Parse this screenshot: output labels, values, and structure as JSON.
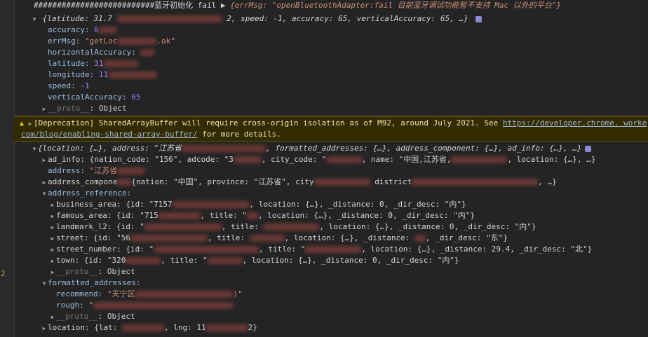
{
  "gutter": {
    "line_number": "2"
  },
  "log": {
    "head_prefix": "##########################蓝牙初始化 fail ▶",
    "head_obj": "{errMsg: \"openBluetoothAdapter:fail 目前蓝牙调试功能暂不支持 Mac 以外的平台\"}",
    "loc_summary_a": "{latitude: 31.7",
    "loc_summary_b": "2, speed: -1, accuracy: 65, verticalAccuracy: 65, …}",
    "accuracy_key": "accuracy: ",
    "accuracy_val": "6",
    "errmsg_key": "errMsg: ",
    "errmsg_val_a": "\"getLoc",
    "errmsg_val_b": ".ok\"",
    "horiz_key": "horizontalAccuracy: ",
    "latitude_key": "latitude: ",
    "latitude_val": "31",
    "longitude_key": "longitude: ",
    "longitude_val": "11",
    "speed_key": "speed: ",
    "speed_val": "-1",
    "vert_key": "verticalAccuracy: ",
    "vert_val": "65",
    "proto_key": "__proto__",
    "proto_val": ": Object"
  },
  "warning": {
    "line1_text": "[Deprecation] SharedArrayBuffer will require cross-origin isolation as of M92, around July 2021. See ",
    "line1_link": "https://developer.chrome.",
    "line1_tail": " worke",
    "line2_link": "com/blog/enabling-shared-array-buffer/",
    "line2_text": " for more details."
  },
  "result": {
    "summary_a": "{location: {…}, address: \"江苏省",
    "summary_b": ", formatted_addresses: {…}, address_component: {…}, ad_info: {…}, …}",
    "ad_info_a": "ad_info: {nation_code: \"156\", adcode: \"3",
    "ad_info_b": ", city_code: \"",
    "ad_info_c": ", name: \"中国,江苏省,",
    "ad_info_d": ", location: {…}, …}",
    "address_key": "address: ",
    "address_val": "\"江苏省",
    "addr_comp_a": "address_compone",
    "addr_comp_b": "{nation: \"中国\", province: \"江苏省\", city",
    "addr_comp_c": " district",
    "addr_comp_d": ", …}",
    "addr_ref_key": "address_reference:",
    "business_a": "business_area: {id: \"7157",
    "business_b": ", location: {…}, _distance: 0, _dir_desc: \"内\"}",
    "famous_a": "famous_area: {id: \"715",
    "famous_b": ", title: \"",
    "famous_c": ", location: {…}, _distance: 0, _dir_desc: \"内\"}",
    "landmark_a": "landmark_l2: {id: \"",
    "landmark_b": ", title: ",
    "landmark_c": ", location: {…}, _distance: 0, _dir_desc: \"内\"}",
    "street_a": "street: {id: \"56",
    "street_b": ", title: ",
    "street_c": ", location: {…}, _distance: ",
    "street_d": ", _dir_desc: \"东\"}",
    "street_num_a": "street_number: {id: \"",
    "street_num_b": ", title: \"",
    "street_num_c": ", location: {…}, _distance: 29.4, _dir_desc: \"北\"}",
    "town_a": "town: {id: \"320",
    "town_b": ", title: \"",
    "town_c": ", location: {…}, _distance: 0, _dir_desc: \"内\"}",
    "proto": "__proto__",
    "proto_val": ": Object",
    "formatted_key": "formatted_addresses:",
    "recommend_key": "recommend: ",
    "recommend_val_a": "\"天宁区",
    "recommend_val_b": ")\"",
    "rough_key": "rough: ",
    "rough_val": "\"",
    "location_a": "location: {lat: ",
    "location_b": ", lng: 11",
    "location_c": "2}"
  },
  "colors": {
    "background": "#242424",
    "warning_bg": "#332b00",
    "string": "#ce9178",
    "number": "#9980ff",
    "key": "#9bbbdc"
  }
}
